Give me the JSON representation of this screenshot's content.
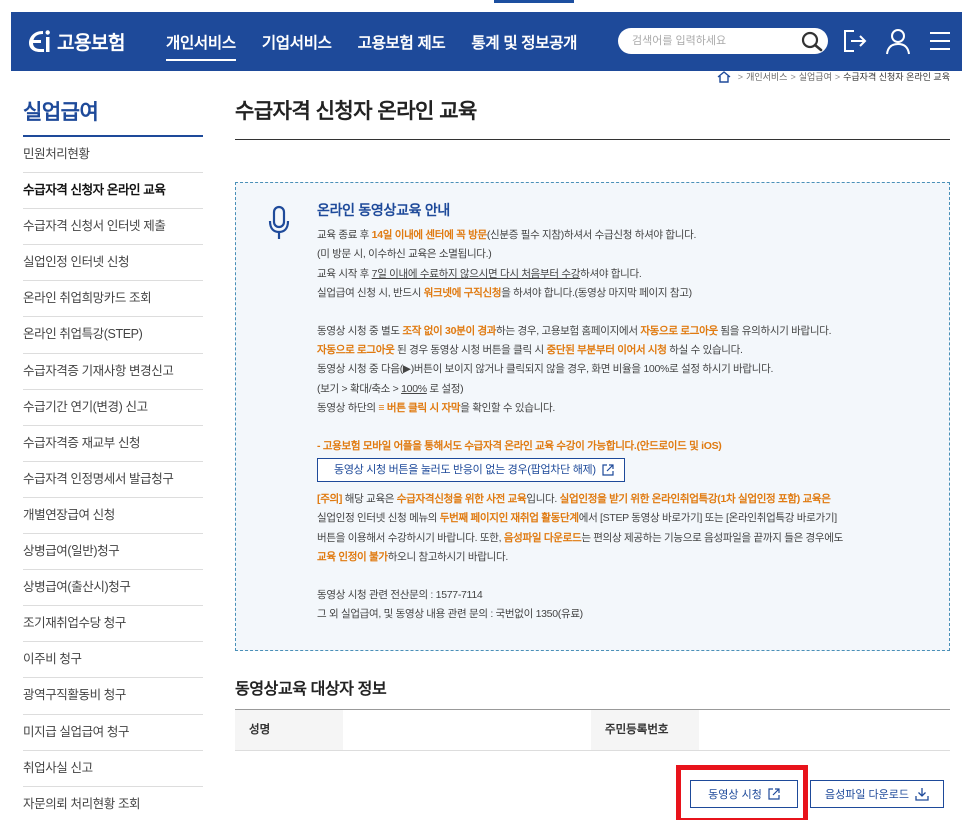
{
  "header": {
    "logo_text": "고용보험",
    "nav": [
      "개인서비스",
      "기업서비스",
      "고용보험 제도",
      "통계 및 정보공개"
    ],
    "search_placeholder": "검색어를 입력하세요"
  },
  "breadcrumb": [
    "개인서비스",
    "실업급여",
    "수급자격 신청자 온라인 교육"
  ],
  "sidebar": {
    "title": "실업급여",
    "items": [
      "민원처리현황",
      "수급자격 신청자 온라인 교육",
      "수급자격 신청서 인터넷 제출",
      "실업인정 인터넷 신청",
      "온라인 취업희망카드 조회",
      "온라인 취업특강(STEP)",
      "수급자격증 기재사항 변경신고",
      "수급기간 연기(변경) 신고",
      "수급자격증 재교부 신청",
      "수급자격 인정명세서 발급청구",
      "개별연장급여 신청",
      "상병급여(일반)청구",
      "상병급여(출산시)청구",
      "조기재취업수당 청구",
      "이주비 청구",
      "광역구직활동비 청구",
      "미지급 실업급여 청구",
      "취업사실 신고",
      "자문의뢰 처리현황 조회"
    ],
    "active_index": 1
  },
  "main": {
    "title": "수급자격 신청자 온라인 교육",
    "notice": {
      "title": "온라인 동영상교육 안내",
      "p1": {
        "a": "교육 종료 후 ",
        "b": "14일 이내에 센터에 꼭 방문",
        "c": "(신분증 필수 지참)하셔서 수급신청 하셔야 합니다."
      },
      "p2": "(미 방문 시, 이수하신 교육은 소멸됩니다.)",
      "p3": {
        "a": "교육 시작 후 ",
        "b": "7일 이내에 수료하지 않으시면 다시 처음부터 수강",
        "c": "하셔야 합니다."
      },
      "p4": {
        "a": "실업급여 신청 시, 반드시 ",
        "b": "워크넷에 구직신청",
        "c": "을 하셔야 합니다.(동영상 마지막 페이지 참고)"
      },
      "p5": {
        "a": "동영상 시청 중 별도 ",
        "b": "조작 없이 30분이 경과",
        "c": "하는 경우, 고용보험 홈페이지에서 ",
        "d": "자동으로 로그아웃",
        "e": " 됨을 유의하시기 바랍니다."
      },
      "p6": {
        "a": "자동으로 로그아웃",
        "b": " 된 경우 동영상 시청 버튼을 클릭 시 ",
        "c": "중단된 부분부터 이어서 시청",
        "d": " 하실 수 있습니다."
      },
      "p7": "동영상 시청 중 다음(▶)버튼이 보이지 않거나 클릭되지 않을 경우, 화면 비율을 100%로 설정 하시기 바랍니다.",
      "p8": {
        "a": "(보기 > 확대/축소 > ",
        "b": "100%",
        "c": " 로 설정)"
      },
      "p9": {
        "a": "동영상 하단의 ",
        "b": "≡ 버튼 클릭 시 자막",
        "c": "을 확인할 수 있습니다."
      },
      "mobile": "- 고용보험 모바일 어플을 통해서도 수급자격 온라인 교육 수강이 가능합니다.(안드로이드 및 iOS)",
      "popup_btn": "동영상 시청 버튼을 눌러도 반응이 없는 경우(팝업차단 해제)",
      "c1": {
        "a": "[주의]",
        "b": " 해당 교육은 ",
        "c": "수급자격신청을 위한 사전 교육",
        "d": "입니다. ",
        "e": "실업인정을 받기 위한 온라인취업특강(1차 실업인정 포함) 교육은"
      },
      "c2": {
        "a": "실업인정 인터넷 신청 메뉴의 ",
        "b": "두번째 페이지인 재취업 활동단계",
        "c": "에서 [STEP 동영상 바로가기] 또는 [온라인취업특강 바로가기]"
      },
      "c3": {
        "a": "버튼을 이용해서 수강하시기 바랍니다. 또한, ",
        "b": "음성파일 다운로드",
        "c": "는 편의상 제공하는 기능으로 음성파일을 끝까지 들은 경우에도"
      },
      "c4": {
        "a": "교육 인정이 불가",
        "b": "하오니 참고하시기 바랍니다."
      },
      "contact1": "동영상 시청 관련 전산문의 : 1577-7114",
      "contact2": "그 외 실업급여, 및 동영상 내용 관련 문의 : 국번없이 1350(유료)"
    },
    "section_title": "동영상교육 대상자 정보",
    "table": {
      "name_label": "성명",
      "name_value": "",
      "rrn_label": "주민등록번호",
      "rrn_value": ""
    },
    "buttons": {
      "watch": "동영상 시청",
      "audio": "음성파일 다운로드"
    }
  },
  "colors": {
    "brand": "#1e4a9a",
    "accent": "#e07a10",
    "highlight": "#e8131b"
  }
}
